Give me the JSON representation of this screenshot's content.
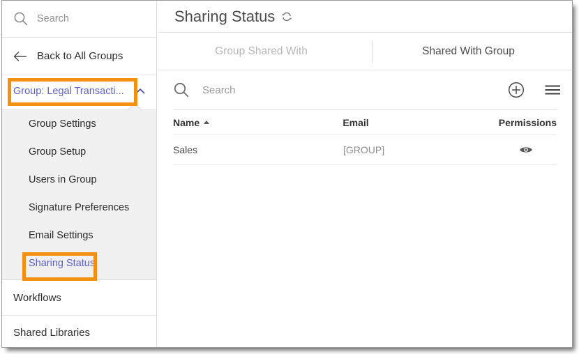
{
  "sidebar": {
    "search": {
      "placeholder": "Search",
      "icon": "search-icon"
    },
    "back": {
      "label": "Back to All Groups",
      "icon": "arrow-left-icon"
    },
    "group_header": {
      "label": "Group: Legal Transacti...",
      "icon": "chevron-up-icon",
      "highlighted": true
    },
    "submenu": [
      {
        "label": "Group Settings",
        "active": false
      },
      {
        "label": "Group Setup",
        "active": false
      },
      {
        "label": "Users in Group",
        "active": false
      },
      {
        "label": "Signature Preferences",
        "active": false
      },
      {
        "label": "Email Settings",
        "active": false
      },
      {
        "label": "Sharing Status",
        "active": true,
        "highlighted": true
      }
    ],
    "nav": [
      {
        "label": "Workflows"
      },
      {
        "label": "Shared Libraries"
      }
    ]
  },
  "main": {
    "title": "Sharing Status",
    "refresh_icon": "refresh-icon",
    "tabs": [
      {
        "label": "Group Shared With",
        "active": false
      },
      {
        "label": "Shared With Group",
        "active": true
      }
    ],
    "toolbar": {
      "search_placeholder": "Search",
      "search_value": "",
      "search_icon": "search-icon",
      "add_icon": "plus-circle-icon",
      "menu_icon": "hamburger-menu-icon"
    },
    "table": {
      "columns": [
        {
          "label": "Name",
          "sort": "asc"
        },
        {
          "label": "Email",
          "sort": "none"
        },
        {
          "label": "Permissions",
          "sort": "none"
        }
      ],
      "rows": [
        {
          "name": "Sales",
          "email": "[GROUP]",
          "permission_icon": "eye-icon"
        }
      ]
    }
  },
  "colors": {
    "highlight_box": "#f29111",
    "link": "#5b5fc7",
    "submenu_bg": "#f0f0f0",
    "text": "#2c2c2c",
    "muted": "#9a9a9a"
  }
}
